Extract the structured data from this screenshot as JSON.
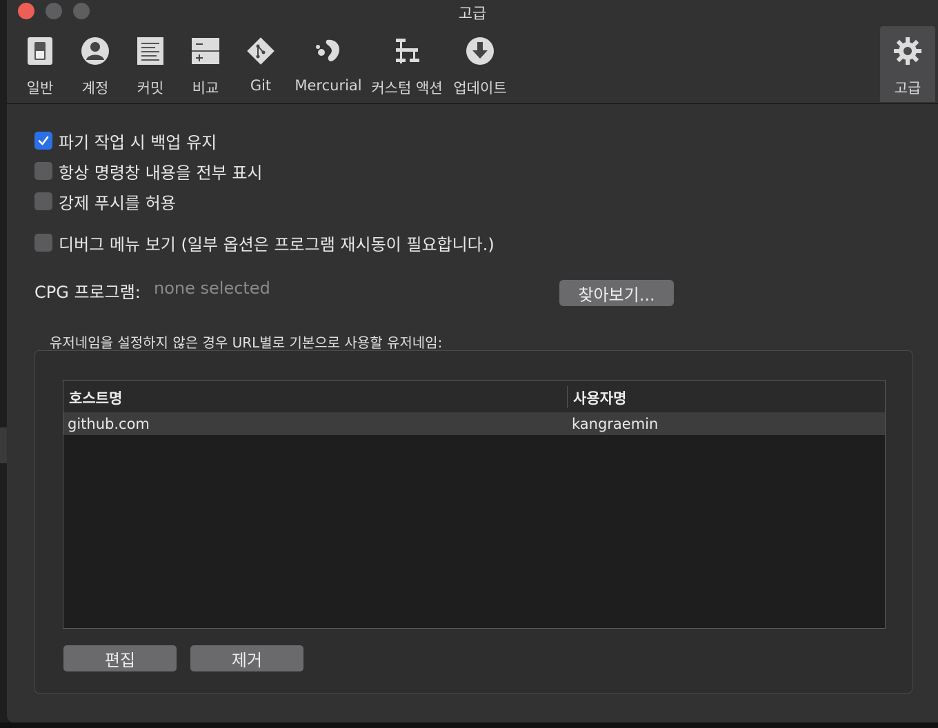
{
  "window": {
    "title": "고급"
  },
  "toolbar": {
    "items": [
      {
        "label": "일반",
        "icon": "general-switch-icon"
      },
      {
        "label": "계정",
        "icon": "account-person-icon"
      },
      {
        "label": "커밋",
        "icon": "commit-document-icon"
      },
      {
        "label": "비교",
        "icon": "diff-compare-icon"
      },
      {
        "label": "Git",
        "icon": "git-branch-icon"
      },
      {
        "label": "Mercurial",
        "icon": "mercurial-icon"
      },
      {
        "label": "커스텀 액션",
        "icon": "custom-actions-icon"
      },
      {
        "label": "업데이트",
        "icon": "update-download-icon"
      },
      {
        "label": "고급",
        "icon": "gear-icon",
        "selected": true
      }
    ]
  },
  "options": [
    {
      "label": "파기 작업 시 백업 유지",
      "checked": true
    },
    {
      "label": "항상 명령창 내용을 전부 표시",
      "checked": false
    },
    {
      "label": "강제 푸시를 허용",
      "checked": false
    },
    {
      "label": "디버그 메뉴 보기 (일부 옵션은 프로그램 재시동이 필요합니다.)",
      "checked": false
    }
  ],
  "cpg": {
    "label": "CPG 프로그램:",
    "value": "none selected",
    "browse_label": "찾아보기..."
  },
  "usernames": {
    "group_label": "유저네임을 설정하지 않은 경우 URL별로 기본으로 사용할 유저네임:",
    "columns": [
      "호스트명",
      "사용자명"
    ],
    "rows": [
      {
        "host": "github.com",
        "user": "kangraemin"
      }
    ],
    "edit_label": "편집",
    "remove_label": "제거"
  },
  "colors": {
    "accent": "#2d6fe6",
    "close": "#ed5e55"
  }
}
